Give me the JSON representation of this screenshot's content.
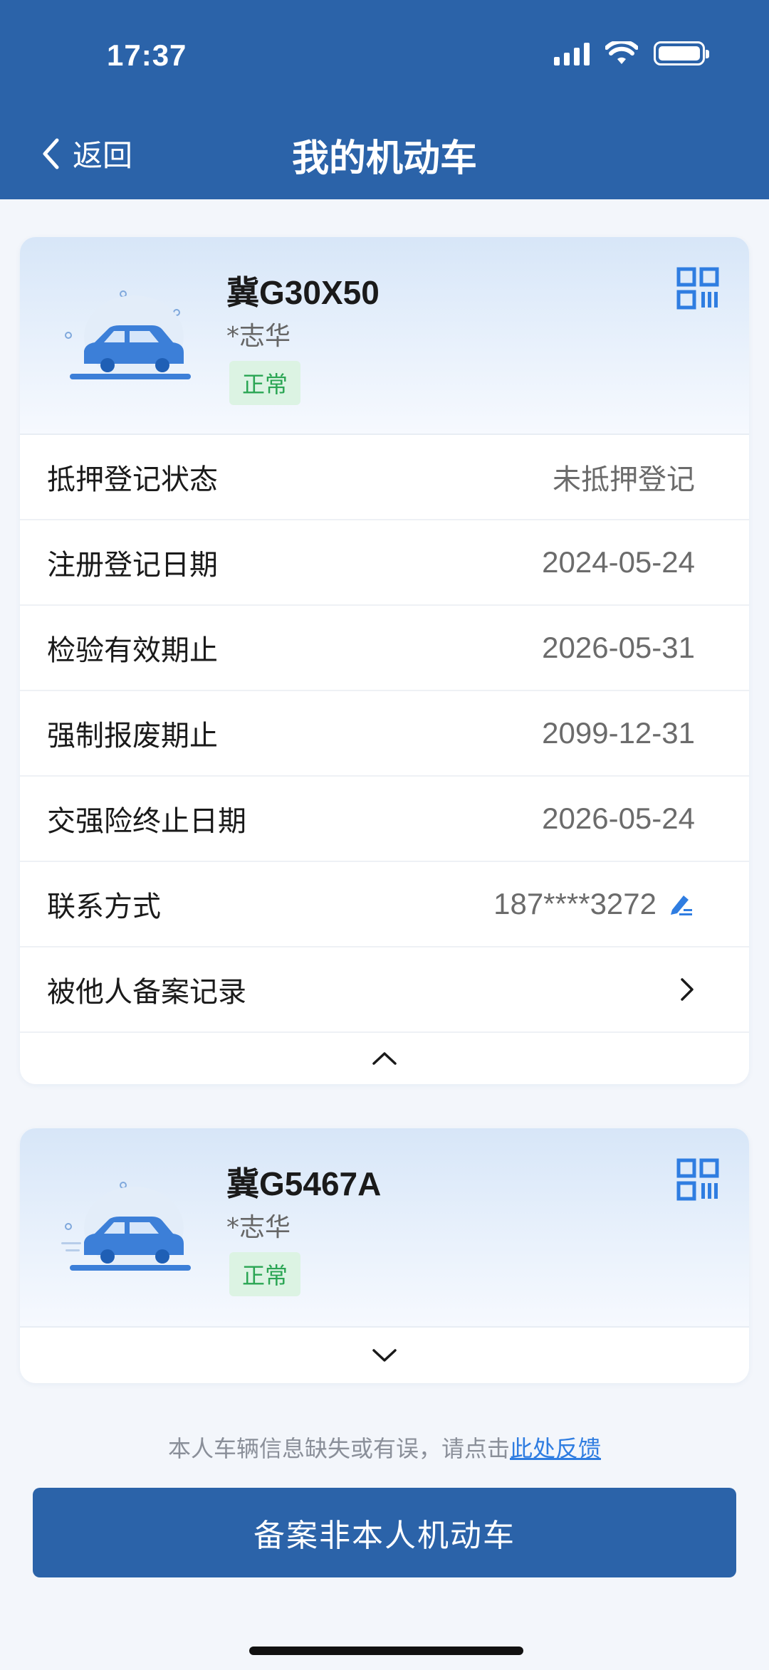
{
  "status_bar": {
    "time": "17:37"
  },
  "nav": {
    "back_label": "返回",
    "title": "我的机动车"
  },
  "vehicles": [
    {
      "plate": "冀G30X50",
      "owner": "*志华",
      "status": "正常",
      "expanded": true,
      "rows": [
        {
          "label": "抵押登记状态",
          "value": "未抵押登记"
        },
        {
          "label": "注册登记日期",
          "value": "2024-05-24"
        },
        {
          "label": "检验有效期止",
          "value": "2026-05-31"
        },
        {
          "label": "强制报废期止",
          "value": "2099-12-31"
        },
        {
          "label": "交强险终止日期",
          "value": "2026-05-24"
        },
        {
          "label": "联系方式",
          "value": "187****3272"
        },
        {
          "label": "被他人备案记录",
          "value": ""
        }
      ]
    },
    {
      "plate": "冀G5467A",
      "owner": "*志华",
      "status": "正常",
      "expanded": false
    }
  ],
  "feedback": {
    "text": "本人车辆信息缺失或有误，请点击",
    "link": "此处反馈"
  },
  "primary_button": "备案非本人机动车",
  "colors": {
    "primary": "#2b63a9",
    "accent": "#2f7de1",
    "badge_bg": "#dcf3e3",
    "badge_text": "#2aa553"
  }
}
